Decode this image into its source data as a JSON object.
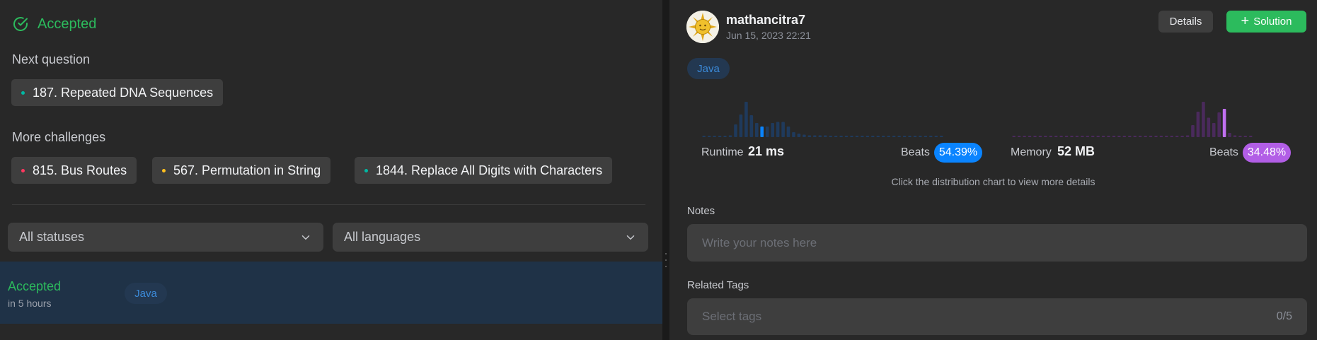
{
  "submission": {
    "status": "Accepted"
  },
  "next_question": {
    "label": "Next question",
    "item": {
      "title": "187. Repeated DNA Sequences",
      "difficulty_color": "#00b8a3"
    }
  },
  "more_challenges": {
    "label": "More challenges",
    "items": [
      {
        "title": "815. Bus Routes",
        "difficulty_color": "#ff375f"
      },
      {
        "title": "567. Permutation in String",
        "difficulty_color": "#ffc01e"
      },
      {
        "title": "1844. Replace All Digits with Characters",
        "difficulty_color": "#00b8a3"
      }
    ]
  },
  "filters": {
    "status": "All statuses",
    "language": "All languages"
  },
  "submission_list": [
    {
      "status": "Accepted",
      "time": "in 5 hours",
      "language": "Java"
    }
  ],
  "detail": {
    "username": "mathancitra7",
    "datetime": "Jun 15, 2023 22:21",
    "details_button": "Details",
    "solution_button": "Solution",
    "language": "Java",
    "runtime": {
      "label": "Runtime",
      "value": "21 ms",
      "beats_label": "Beats",
      "beats": "54.39%",
      "beats_color": "#0a84ff",
      "bars": [
        0.02,
        0.02,
        0.02,
        0.02,
        0.02,
        0.05,
        0.36,
        0.64,
        1.0,
        0.62,
        0.4,
        0.3,
        0.3,
        0.4,
        0.43,
        0.43,
        0.3,
        0.14,
        0.1,
        0.07,
        0.05,
        0.05,
        0.05,
        0.05,
        0.04,
        0.03,
        0.03,
        0.02,
        0.02,
        0.02,
        0.02,
        0.02,
        0.02,
        0.02,
        0.02,
        0.02,
        0.02,
        0.02,
        0.02,
        0.02,
        0.02,
        0.02,
        0.02,
        0.02,
        0.02,
        0.02
      ],
      "highlight_index": 11,
      "bar_color": "#1f3a5c",
      "highlight_color": "#0a84ff"
    },
    "memory": {
      "label": "Memory",
      "value": "52 MB",
      "beats_label": "Beats",
      "beats": "34.48%",
      "beats_color": "#b25ee6",
      "bars": [
        0.02,
        0.02,
        0.02,
        0.02,
        0.02,
        0.02,
        0.02,
        0.02,
        0.02,
        0.02,
        0.02,
        0.02,
        0.02,
        0.02,
        0.02,
        0.02,
        0.02,
        0.02,
        0.02,
        0.02,
        0.02,
        0.02,
        0.02,
        0.02,
        0.02,
        0.02,
        0.02,
        0.02,
        0.02,
        0.02,
        0.02,
        0.02,
        0.02,
        0.05,
        0.34,
        0.72,
        1.0,
        0.55,
        0.4,
        0.7,
        0.8,
        0.12,
        0.05,
        0.02,
        0.02,
        0.02
      ],
      "highlight_index": 40,
      "bar_color": "#4a2a5c",
      "highlight_color": "#c070f0"
    },
    "chart_hint": "Click the distribution chart to view more details",
    "notes_label": "Notes",
    "notes_placeholder": "Write your notes here",
    "tags_label": "Related Tags",
    "tags_placeholder": "Select tags",
    "tags_count": "0/5"
  }
}
